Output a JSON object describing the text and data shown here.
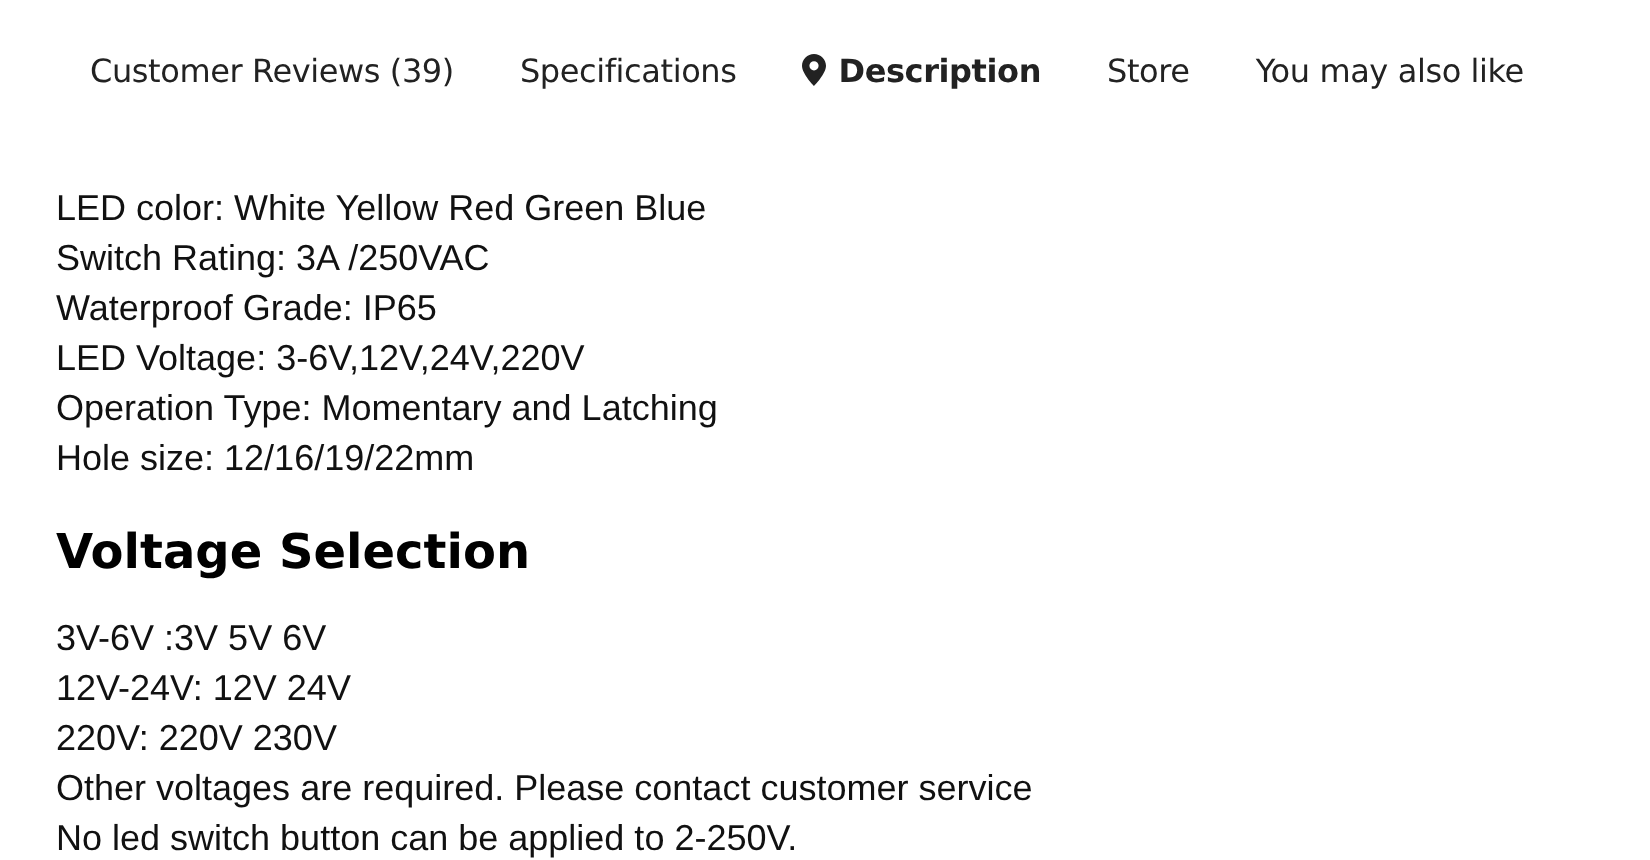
{
  "tabs": [
    {
      "label": "Customer Reviews (39)",
      "selected": false
    },
    {
      "label": "Specifications",
      "selected": false
    },
    {
      "label": "Description",
      "selected": true
    },
    {
      "label": "Store",
      "selected": false
    },
    {
      "label": "You may also like",
      "selected": false
    }
  ],
  "specs": [
    "LED color: White Yellow Red Green Blue",
    "Switch Rating: 3A /250VAC",
    "Waterproof Grade: IP65",
    "LED Voltage: 3-6V,12V,24V,220V",
    "Operation Type: Momentary and Latching",
    "Hole size: 12/16/19/22mm"
  ],
  "voltage_section": {
    "heading": "Voltage Selection",
    "lines": [
      "3V-6V :3V 5V 6V",
      "12V-24V: 12V 24V",
      "220V: 220V 230V",
      "Other voltages are required. Please contact customer service",
      "No led switch button can be applied to 2-250V."
    ]
  }
}
